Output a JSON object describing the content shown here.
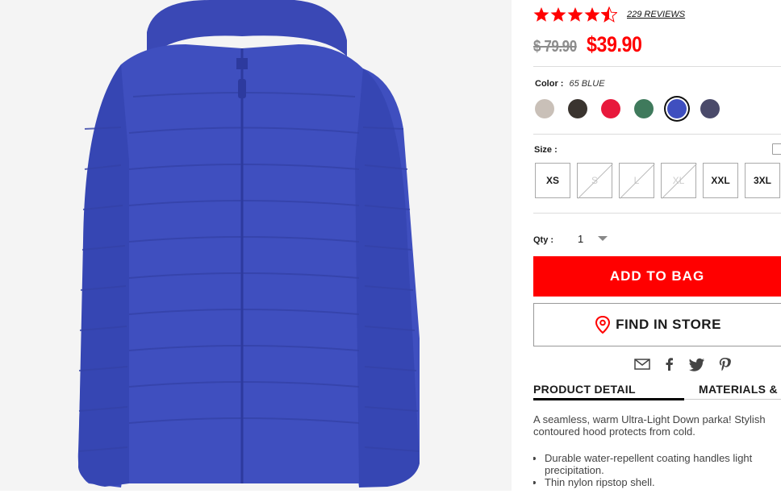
{
  "product": {
    "image_alt": "Blue ultra light down parka",
    "colors_hex": {
      "jacket": "#3f4fbf",
      "jacket_dark": "#2d3a9e",
      "background": "#f4f4f4"
    }
  },
  "rating": {
    "stars": 4.5,
    "reviews_label": "229 REVIEWS",
    "star_color": "#ff0000"
  },
  "price": {
    "original": "$ 79.90",
    "sale": "$39.90"
  },
  "color": {
    "label": "Color :",
    "selected": "65 BLUE",
    "swatches": [
      {
        "name": "beige",
        "hex": "#c9c0b8"
      },
      {
        "name": "dark-brown",
        "hex": "#3a342f"
      },
      {
        "name": "red",
        "hex": "#e8193c"
      },
      {
        "name": "green",
        "hex": "#3f7a5c"
      },
      {
        "name": "blue",
        "hex": "#3f4fbf",
        "selected": true
      },
      {
        "name": "navy",
        "hex": "#4a4a6a"
      }
    ]
  },
  "size": {
    "label": "Size :",
    "options": [
      {
        "label": "XS",
        "available": true
      },
      {
        "label": "S",
        "available": false
      },
      {
        "label": "L",
        "available": false
      },
      {
        "label": "XL",
        "available": false
      },
      {
        "label": "XXL",
        "available": true
      },
      {
        "label": "3XL",
        "available": true
      }
    ]
  },
  "quantity": {
    "label": "Qty :",
    "value": "1"
  },
  "buttons": {
    "add_to_bag": "ADD TO BAG",
    "find_in_store": "FIND IN STORE"
  },
  "share_icons": [
    "mail-icon",
    "facebook-icon",
    "twitter-icon",
    "pinterest-icon"
  ],
  "tabs": [
    {
      "label": "PRODUCT DETAIL",
      "active": true
    },
    {
      "label": "MATERIALS &"
    }
  ],
  "description": {
    "line1": "A seamless, warm Ultra-Light Down parka! Stylish",
    "line2": "contoured hood protects from cold.",
    "bullets": [
      "Durable water-repellent coating handles light precipitation.",
      "Thin nylon ripstop shell."
    ]
  }
}
